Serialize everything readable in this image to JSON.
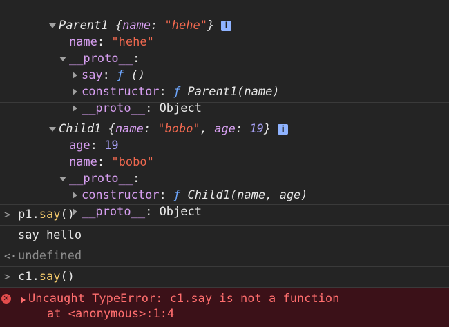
{
  "parent1": {
    "header_name": "Parent1",
    "brace_open": " {",
    "key_name": "name",
    "colon": ": ",
    "value": "\"hehe\"",
    "brace_close": "}",
    "info": "i",
    "prop_name_key": "name",
    "prop_name_value": "\"hehe\"",
    "proto_label": "__proto__",
    "say_key": "say",
    "say_f": "ƒ",
    "say_sig": "()",
    "constructor_key": "constructor",
    "constructor_f": "ƒ",
    "constructor_sig": "Parent1(name)",
    "inner_proto_label": "__proto__",
    "inner_proto_value": "Object"
  },
  "child1": {
    "header_name": "Child1",
    "brace_open": " {",
    "key_name": "name",
    "value_name": "\"bobo\"",
    "key_age": "age",
    "value_age": "19",
    "brace_close": "}",
    "info": "i",
    "prop_age_key": "age",
    "prop_age_value": "19",
    "prop_name_key": "name",
    "prop_name_value": "\"bobo\"",
    "proto_label": "__proto__",
    "constructor_key": "constructor",
    "constructor_f": "ƒ",
    "constructor_sig": "Child1(name, age)",
    "inner_proto_label": "__proto__",
    "inner_proto_value": "Object"
  },
  "console": {
    "cmd1_obj": "p1.",
    "cmd1_method": "say",
    "cmd1_parens": "()",
    "out1": "say hello",
    "ret1": "undefined",
    "cmd2_obj": "c1.",
    "cmd2_method": "say",
    "cmd2_parens": "()",
    "error_line1": "Uncaught TypeError: c1.say is not a function",
    "error_line2": "at <anonymous>:1:4",
    "prompt_in": ">",
    "prompt_out": "<·"
  }
}
